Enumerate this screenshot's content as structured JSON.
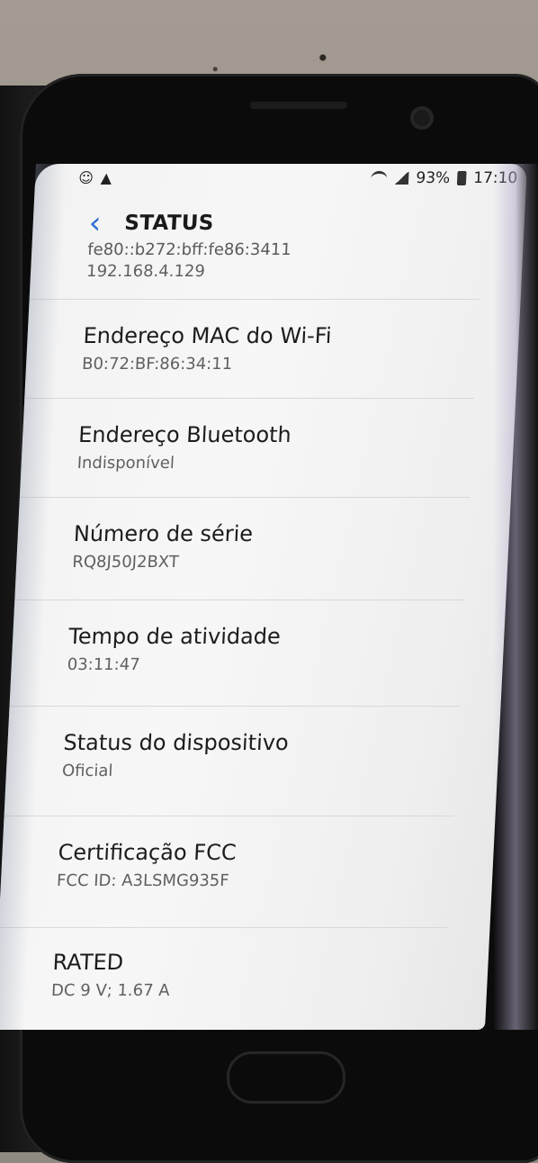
{
  "status_bar": {
    "battery": "93%",
    "time": "17:10",
    "icons": [
      "account-icon",
      "warning-icon",
      "wifi-icon",
      "signal-icon",
      "battery-icon"
    ]
  },
  "appbar": {
    "title": "STATUS"
  },
  "items": [
    {
      "value_a": "fe80::b272:bff:fe86:3411",
      "value_b": "192.168.4.129"
    },
    {
      "label": "Endereço MAC do Wi-Fi",
      "value": "B0:72:BF:86:34:11"
    },
    {
      "label": "Endereço Bluetooth",
      "value": "Indisponível"
    },
    {
      "label": "Número de série",
      "value": "RQ8J50J2BXT"
    },
    {
      "label": "Tempo de atividade",
      "value": "03:11:47"
    },
    {
      "label": "Status do dispositivo",
      "value": "Oficial"
    },
    {
      "label": "Certificação FCC",
      "value": "FCC ID: A3LSMG935F"
    },
    {
      "label": "RATED",
      "value": "DC 9 V; 1.67 A"
    }
  ],
  "colors": {
    "accent": "#2f6fd1",
    "screen_background": "#f4f4f4",
    "text_primary": "#1c1c1c",
    "text_secondary": "#606060"
  }
}
